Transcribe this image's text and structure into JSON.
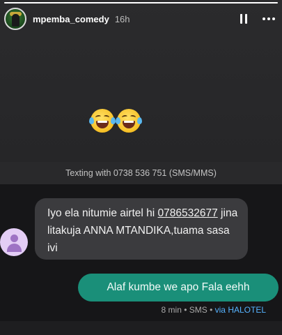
{
  "story": {
    "username": "mpemba_comedy",
    "time_ago": "16h",
    "progress": 1.0,
    "icons": {
      "pause": "pause-icon",
      "more": "more-options-icon"
    },
    "emojis": [
      "face-with-tears-of-joy",
      "face-with-tears-of-joy"
    ]
  },
  "sms": {
    "texting_info": "Texting with 0738 536 751 (SMS/MMS)",
    "incoming": {
      "text_before": "Iyo ela nitumie airtel hi ",
      "phone": "0786532677",
      "text_after": " jina litakuja ANNA MTANDIKA,tuama sasa ivi"
    },
    "outgoing": {
      "text": "Alaf kumbe we apo Fala eehh"
    },
    "meta": {
      "time_type": "8 min • SMS • ",
      "carrier": "via HALOTEL"
    }
  },
  "colors": {
    "outgoing_bubble": "#1a8f79",
    "incoming_bubble": "#3b3b3e",
    "carrier_link": "#56b3ff"
  }
}
